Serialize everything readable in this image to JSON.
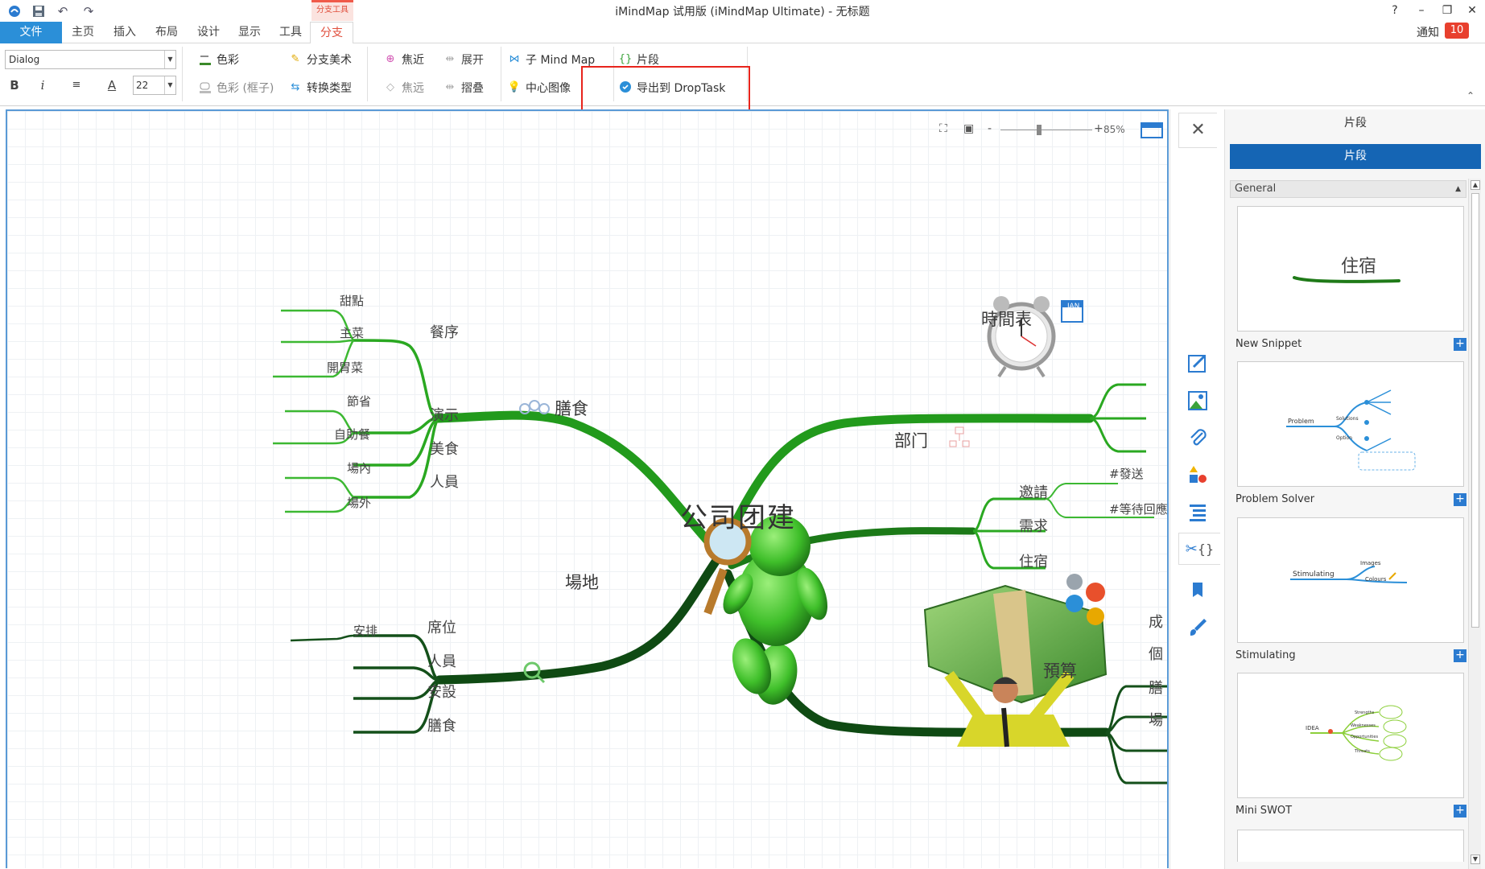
{
  "titlebar": {
    "contextual_tab": "分支工具",
    "title": "iMindMap 试用版 (iMindMap Ultimate) - 无标题",
    "help": "?",
    "minimize": "–",
    "restore": "❐",
    "close": "✕"
  },
  "menu": {
    "file": "文件",
    "tabs": [
      "主页",
      "插入",
      "布局",
      "设计",
      "显示",
      "工具",
      "分支"
    ],
    "active_tab": "分支",
    "notification_label": "通知",
    "notification_count": "10"
  },
  "ribbon": {
    "font_name": "Dialog",
    "font_size": "22",
    "bold": "B",
    "italic": "i",
    "color": "色彩",
    "color_box": "色彩 (框子)",
    "branch_art": "分支美术",
    "convert_type": "转换类型",
    "focus_in": "焦近",
    "focus_out": "焦远",
    "expand": "展开",
    "collapse": "摺叠",
    "sub_mindmap": "子 Mind Map",
    "central_image": "中心图像",
    "snippet": "片段",
    "export_droptask": "导出到 DropTask"
  },
  "zoom": {
    "percent": "85%",
    "minus": "-",
    "plus": "+",
    "level": 0.42
  },
  "mindmap": {
    "central": "公司团建",
    "branches": {
      "food": "膳食",
      "venue": "場地",
      "schedule": "時間表",
      "department": "部门",
      "budget": "預算"
    },
    "food_children": [
      "餐序",
      "演示",
      "美食",
      "人員"
    ],
    "course_leaves": [
      "甜點",
      "主菜",
      "開胃菜"
    ],
    "demo_leaves": [
      "節省",
      "自助餐"
    ],
    "staff_leaves": [
      "場內",
      "場外"
    ],
    "venue_children": [
      "席位",
      "人員",
      "安設",
      "膳食"
    ],
    "seat_leaves": [
      "安排"
    ],
    "dept_children": [
      "邀請",
      "需求",
      "住宿"
    ],
    "invite_tags": [
      "#發送",
      "#等待回應"
    ],
    "budget_children": [
      "成",
      "個",
      "膳",
      "場"
    ],
    "calendar_icon": "JAN"
  },
  "panel": {
    "title": "片段",
    "header": "片段",
    "group": "General",
    "snippets": [
      {
        "name": "New Snippet",
        "preview_text": "住宿"
      },
      {
        "name": "Problem Solver",
        "preview_labels": [
          "Problem",
          "Solutions",
          "Option"
        ]
      },
      {
        "name": "Stimulating",
        "preview_labels": [
          "Stimulating",
          "Images",
          "Colours"
        ]
      },
      {
        "name": "Mini SWOT",
        "preview_labels": [
          "IDEA",
          "Strengths",
          "Weaknesses",
          "Opportunities",
          "Threats"
        ]
      }
    ]
  },
  "colors": {
    "accent": "#2b8fd8",
    "panel_header": "#1565b4",
    "branch_green": "#229a1c",
    "branch_dark": "#0f4a13",
    "highlight": "#e8241c"
  }
}
